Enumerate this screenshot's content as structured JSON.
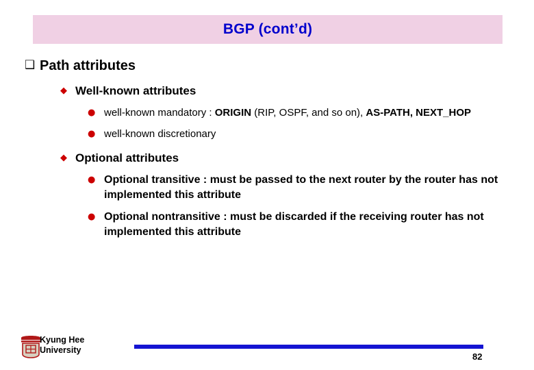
{
  "slide": {
    "title": "BGP (cont’d)",
    "title_bg": "#f0d0e4",
    "title_color": "#0000cc",
    "bullets": {
      "l1_marker": "❑",
      "l2_marker": "◆",
      "l3_marker": "●"
    },
    "level1": {
      "text": "Path attributes"
    },
    "sections": [
      {
        "heading": "Well-known attributes",
        "items": [
          {
            "prefix": "well-known mandatory : ",
            "bold1": "ORIGIN",
            "mid": " (RIP, OSPF, and so on), ",
            "bold2": "AS-PATH, NEXT_HOP",
            "plain": "",
            "size": "small"
          },
          {
            "prefix": "well-known discretionary",
            "bold1": "",
            "mid": "",
            "bold2": "",
            "plain": "",
            "size": "small"
          }
        ]
      },
      {
        "heading": "Optional attributes",
        "items": [
          {
            "prefix": "Optional transitive : must be passed to the next router by the router has not implemented this attribute",
            "bold1": "",
            "mid": "",
            "bold2": "",
            "plain": "",
            "size": "big"
          },
          {
            "prefix": "Optional nontransitive : must be discarded if the receiving router has not implemented this attribute",
            "bold1": "",
            "mid": "",
            "bold2": "",
            "plain": "",
            "size": "big"
          }
        ]
      }
    ],
    "footer": {
      "university_line1": "Kyung Hee",
      "university_line2": "University",
      "page_number": "82",
      "rule_color": "#1414d2"
    }
  }
}
